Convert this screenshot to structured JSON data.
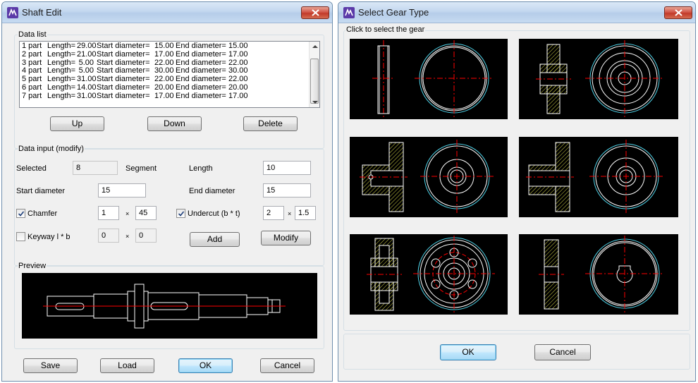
{
  "shaft_edit": {
    "title": "Shaft Edit",
    "data_list": {
      "label": "Data list",
      "rows": [
        {
          "part": "1 part",
          "length": "29.00",
          "start": "15.00",
          "end": "15.00"
        },
        {
          "part": "2 part",
          "length": "21.00",
          "start": "17.00",
          "end": "17.00"
        },
        {
          "part": "3 part",
          "length": "5.00",
          "start": "22.00",
          "end": "22.00"
        },
        {
          "part": "4 part",
          "length": "5.00",
          "start": "30.00",
          "end": "30.00"
        },
        {
          "part": "5 part",
          "length": "31.00",
          "start": "22.00",
          "end": "22.00"
        },
        {
          "part": "6 part",
          "length": "14.00",
          "start": "20.00",
          "end": "20.00"
        },
        {
          "part": "7 part",
          "length": "31.00",
          "start": "17.00",
          "end": "17.00"
        }
      ],
      "length_prefix": "Length=",
      "start_prefix": "Start diameter=",
      "end_prefix": "End diameter=",
      "buttons": {
        "up": "Up",
        "down": "Down",
        "delete": "Delete"
      }
    },
    "data_input": {
      "label": "Data input (modify)",
      "selected_label": "Selected",
      "selected_value": "8",
      "segment_label": "Segment",
      "length_label": "Length",
      "length_value": "10",
      "start_diameter_label": "Start diameter",
      "start_diameter_value": "15",
      "end_diameter_label": "End diameter",
      "end_diameter_value": "15",
      "chamfer_label": "Chamfer",
      "chamfer_checked": true,
      "chamfer_a": "1",
      "chamfer_b": "45",
      "undercut_label": "Undercut (b * t)",
      "undercut_checked": true,
      "undercut_b": "2",
      "undercut_t": "1.5",
      "keyway_label": "Keyway l * b",
      "keyway_checked": false,
      "keyway_l": "0",
      "keyway_b": "0",
      "times_sign": "×",
      "add_button": "Add",
      "modify_button": "Modify"
    },
    "preview": {
      "label": "Preview"
    },
    "footer": {
      "save": "Save",
      "load": "Load",
      "ok": "OK",
      "cancel": "Cancel"
    }
  },
  "gear_type": {
    "title": "Select Gear Type",
    "group_label": "Click to select the gear",
    "gears": [
      "spur-gear",
      "hub-gear",
      "flange-gear-with-hole",
      "flange-gear",
      "web-gear-with-holes",
      "plain-gear-with-keyway"
    ],
    "footer": {
      "ok": "OK",
      "cancel": "Cancel"
    }
  },
  "colors": {
    "drawing_white": "#ffffff",
    "centerline_red": "#ff0000",
    "pitch_cyan": "#4fd2e8",
    "hatch_yellow": "#d8d84a",
    "titlebar": "#c3d7ef",
    "window_bg": "#f0f0f0"
  },
  "icons": {
    "app": "app-logo-icon",
    "close": "close-icon",
    "check": "check-icon"
  }
}
